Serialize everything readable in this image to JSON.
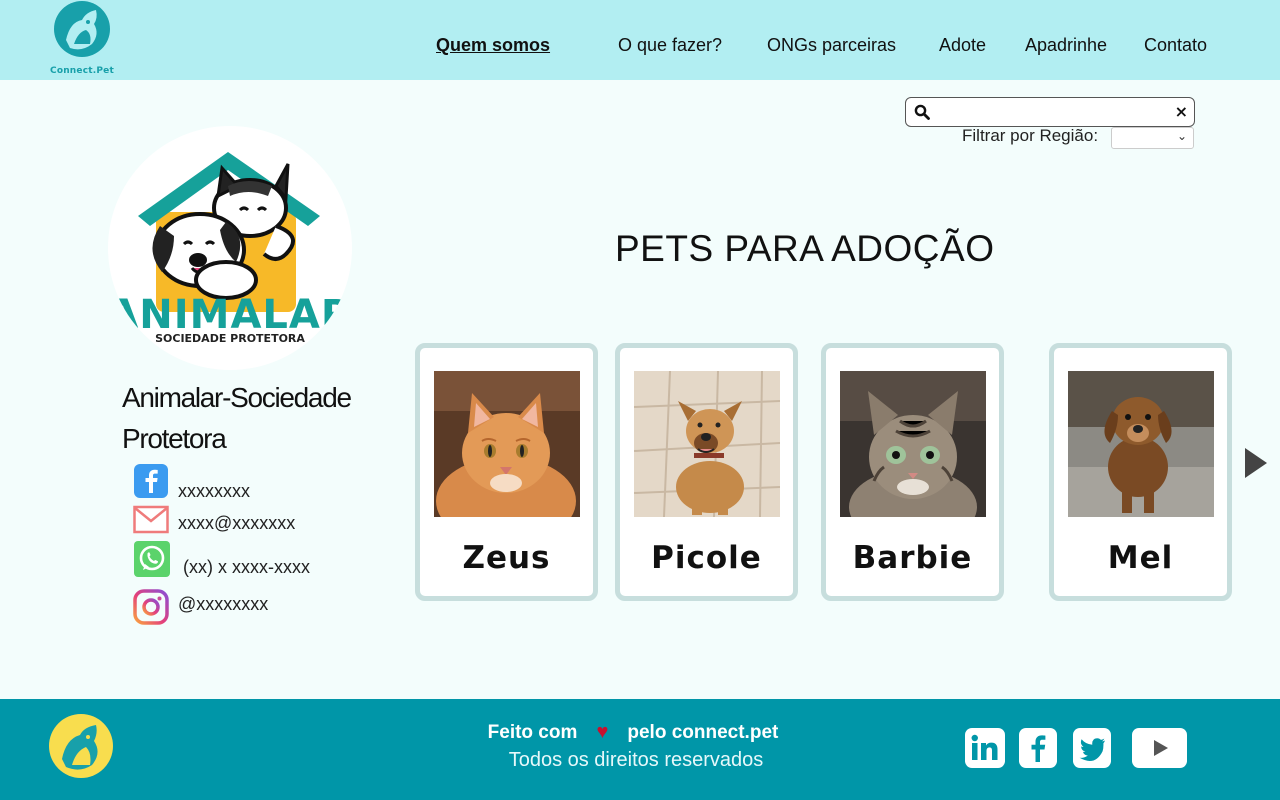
{
  "brand": {
    "name": "Connect.Pet"
  },
  "nav": {
    "items": [
      {
        "label": "Quem somos",
        "active": true
      },
      {
        "label": "O que fazer?",
        "active": false
      },
      {
        "label": "ONGs parceiras",
        "active": false
      },
      {
        "label": "Adote",
        "active": false
      },
      {
        "label": "Apadrinhe",
        "active": false
      },
      {
        "label": "Contato",
        "active": false
      }
    ]
  },
  "search": {
    "value": "",
    "placeholder": "",
    "clear_label": "×",
    "icon": "search-icon"
  },
  "filter": {
    "label": "Filtrar por Região:",
    "selected": ""
  },
  "ngo": {
    "name_line1": "Animalar-Sociedade",
    "name_line2": "Protetora",
    "logo": {
      "wordmark": "ANIMALAR",
      "tagline": "SOCIEDADE PROTETORA"
    },
    "contacts": {
      "facebook": "xxxxxxxx",
      "email": "xxxx@xxxxxxx",
      "whatsapp": "(xx) x xxxx-xxxx",
      "instagram": "@xxxxxxxx"
    }
  },
  "main": {
    "title": "PETS PARA ADOÇÃO"
  },
  "pets": [
    {
      "name": "Zeus"
    },
    {
      "name": "Picole"
    },
    {
      "name": "Barbie"
    },
    {
      "name": "Mel"
    }
  ],
  "footer": {
    "made_before": "Feito com",
    "made_after": "pelo connect.pet",
    "rights": "Todos os direitos reservados",
    "social": [
      "linkedin-icon",
      "facebook-icon",
      "twitter-icon",
      "youtube-icon"
    ]
  },
  "colors": {
    "header_bg": "#b2eef2",
    "page_bg": "#f3fdfc",
    "footer_bg": "#0096a8",
    "brand_teal": "#18a0aa",
    "card_border": "#c7dedd",
    "heart": "#c8102e",
    "footer_logo_yellow": "#f8dd4e"
  }
}
